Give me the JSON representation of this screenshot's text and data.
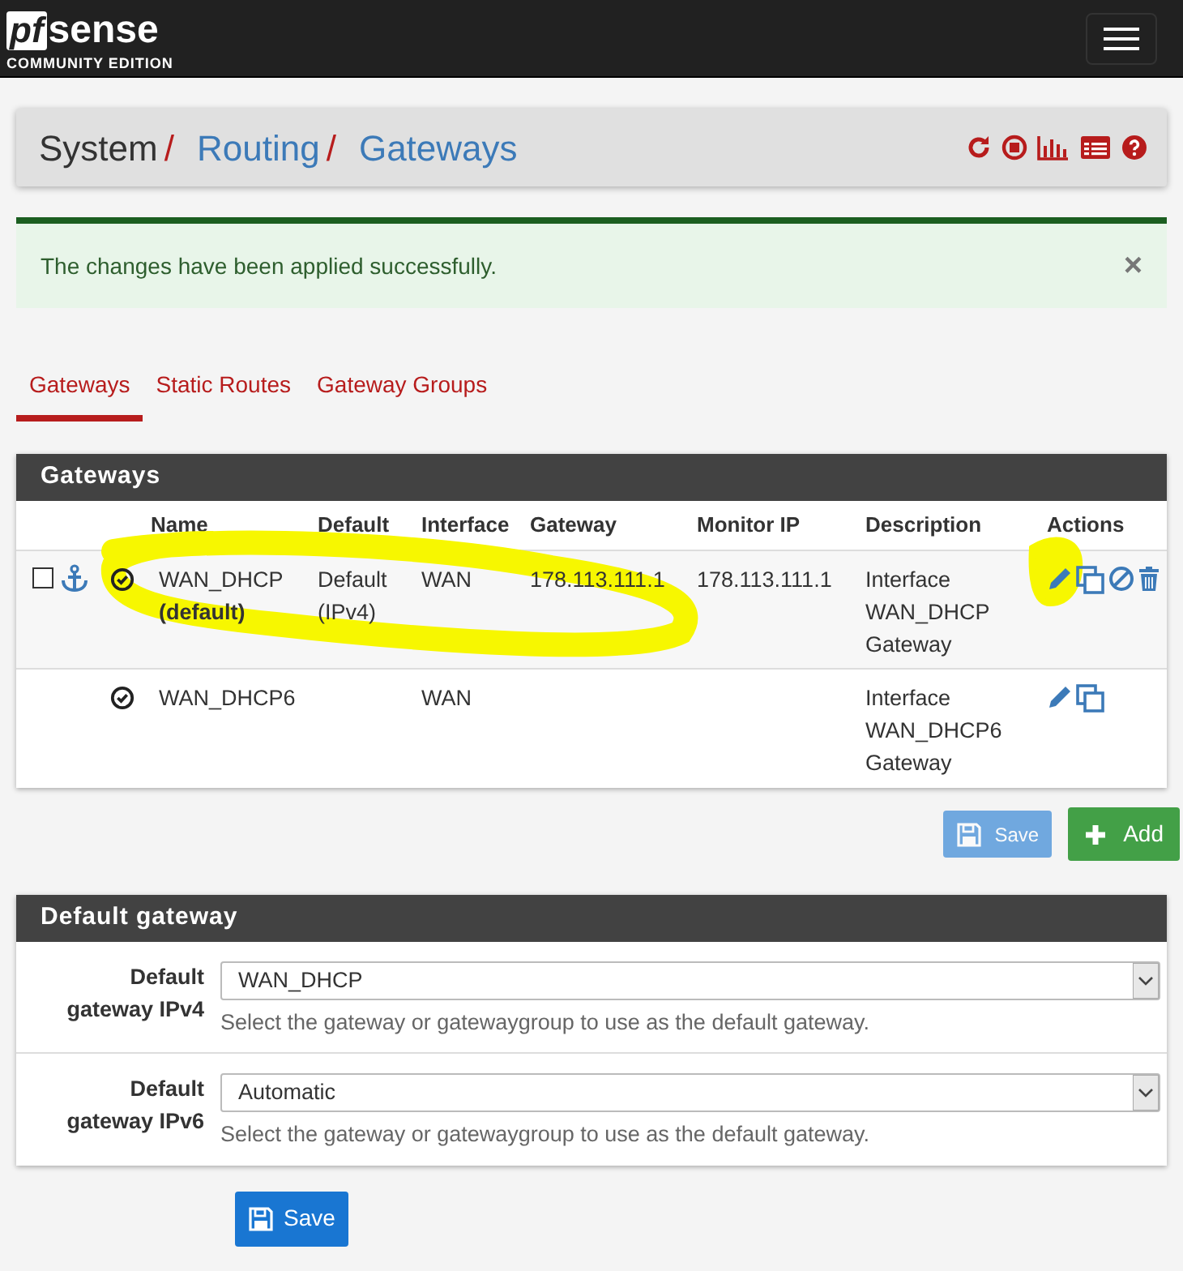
{
  "navbar": {
    "logo_mark": "pf",
    "logo_word": "sense",
    "logo_subtitle": "COMMUNITY EDITION"
  },
  "breadcrumb": [
    {
      "label": "System",
      "link": false,
      "separator": "/"
    },
    {
      "label": "Routing",
      "link": true,
      "separator": "/"
    },
    {
      "label": "Gateways",
      "link": true
    }
  ],
  "header_icons": [
    {
      "kind": "reload"
    },
    {
      "kind": "stop"
    },
    {
      "kind": "chart"
    },
    {
      "kind": "list"
    },
    {
      "kind": "help"
    }
  ],
  "alert": {
    "text": "The changes have been applied successfully.",
    "close": "×"
  },
  "tabs": [
    {
      "label": "Gateways",
      "selected": true
    },
    {
      "label": "Static Routes",
      "selected": false
    },
    {
      "label": "Gateway Groups",
      "selected": false
    }
  ],
  "gateways_panel": {
    "title": "Gateways",
    "columns": [
      "Name",
      "Default",
      "Interface",
      "Gateway",
      "Monitor IP",
      "Description",
      "Actions"
    ],
    "rows": [
      {
        "selectable": true,
        "checked": false,
        "anchor": true,
        "name": "WAN_DHCP",
        "name_note": "(default)",
        "default": "Default (IPv4)",
        "interface": "WAN",
        "gateway": "178.113.111.1",
        "monitor_ip": "178.113.111.1",
        "description": "Interface WAN_DHCP Gateway",
        "actions": [
          {
            "kind": "edit"
          },
          {
            "kind": "copy"
          },
          {
            "kind": "disable"
          },
          {
            "kind": "delete"
          }
        ]
      },
      {
        "selectable": false,
        "anchor": false,
        "name": "WAN_DHCP6",
        "name_note": "",
        "default": "",
        "interface": "WAN",
        "gateway": "",
        "monitor_ip": "",
        "description": "Interface WAN_DHCP6 Gateway",
        "actions": [
          {
            "kind": "edit"
          },
          {
            "kind": "copy"
          }
        ]
      }
    ]
  },
  "table_buttons": [
    {
      "label": "Save",
      "kind": "save",
      "disabled": true
    },
    {
      "label": "Add",
      "kind": "add",
      "disabled": false
    }
  ],
  "default_gateway_panel": {
    "title": "Default gateway",
    "fields": [
      {
        "label": "Default gateway IPv4",
        "value": "WAN_DHCP",
        "help": "Select the gateway or gatewaygroup to use as the default gateway."
      },
      {
        "label": "Default gateway IPv6",
        "value": "Automatic",
        "help": "Select the gateway or gatewaygroup to use as the default gateway."
      }
    ]
  },
  "save_button": {
    "label": "Save"
  }
}
